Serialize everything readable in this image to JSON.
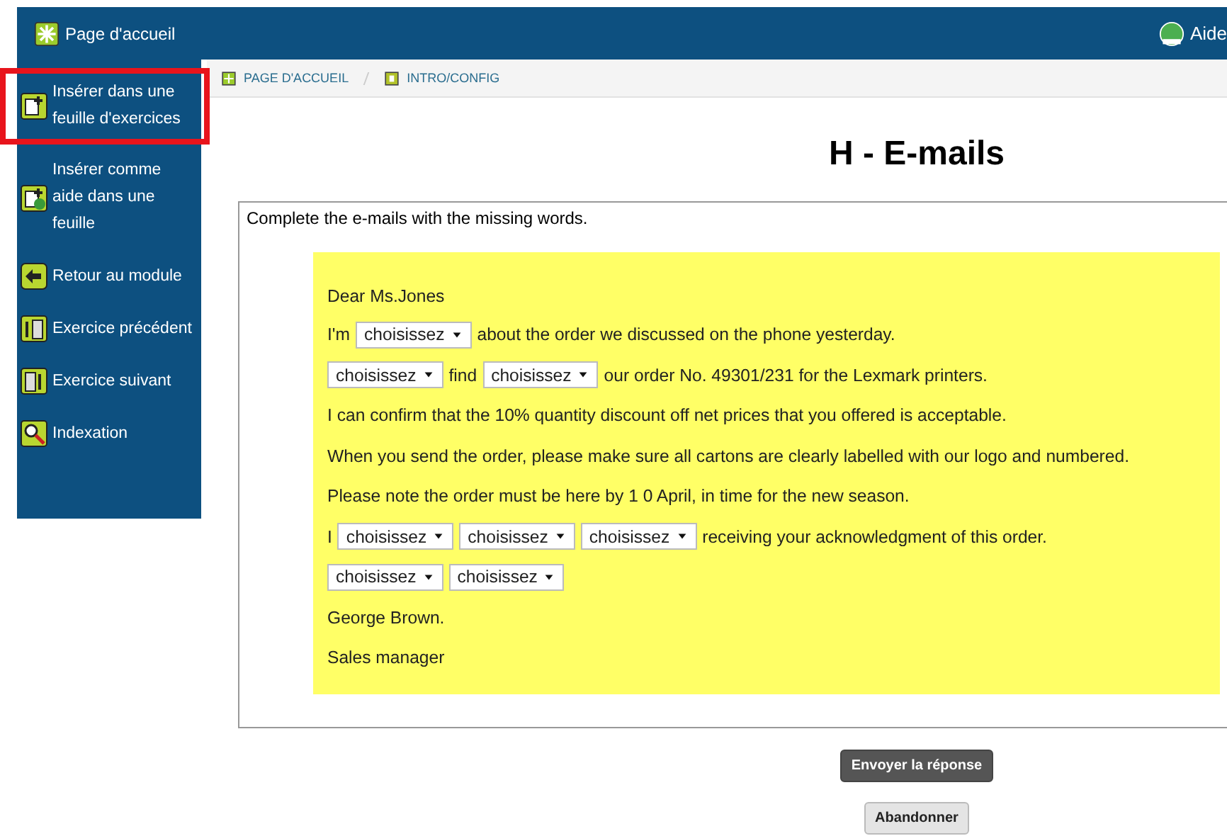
{
  "header": {
    "home": "Page d'accueil",
    "help": "Aide"
  },
  "sidebar": {
    "items": [
      {
        "label": "Insérer dans une feuille d'exercices",
        "highlighted": true
      },
      {
        "label": "Insérer comme aide dans une feuille",
        "highlighted": false
      },
      {
        "label": "Retour au module",
        "highlighted": false
      },
      {
        "label": "Exercice précédent",
        "highlighted": false
      },
      {
        "label": "Exercice suivant",
        "highlighted": false
      },
      {
        "label": "Indexation",
        "highlighted": false
      }
    ]
  },
  "breadcrumb": [
    "PAGE D'ACCUEIL",
    "INTRO/CONFIG"
  ],
  "title": "H - E-mails",
  "exercise": {
    "instruction": "Complete the e-mails with the missing words.",
    "lines": [
      [
        {
          "kind": "text",
          "text": "Dear Ms.Jones"
        }
      ],
      [
        {
          "kind": "text",
          "text": "I'm"
        },
        {
          "kind": "dropdown",
          "text": "choisissez"
        },
        {
          "kind": "text",
          "text": "about the order we discussed on the phone yesterday."
        }
      ],
      [
        {
          "kind": "dropdown",
          "text": "choisissez"
        },
        {
          "kind": "text",
          "text": "find"
        },
        {
          "kind": "dropdown",
          "text": "choisissez"
        },
        {
          "kind": "text",
          "text": "our order No. 49301/231 for the Lexmark printers."
        }
      ],
      [
        {
          "kind": "text",
          "text": "I can confirm that the 10% quantity discount off net prices that you offered is acceptable."
        }
      ],
      [
        {
          "kind": "text",
          "text": "When you send the order, please make sure all cartons are clearly labelled with our logo and numbered."
        }
      ],
      [
        {
          "kind": "text",
          "text": "Please note the order must be here by 1 0 April, in time for the new season."
        }
      ],
      [
        {
          "kind": "text",
          "text": "I"
        },
        {
          "kind": "dropdown",
          "text": "choisissez"
        },
        {
          "kind": "dropdown",
          "text": "choisissez"
        },
        {
          "kind": "dropdown",
          "text": "choisissez"
        },
        {
          "kind": "text",
          "text": "receiving your acknowledgment of this order."
        }
      ],
      [
        {
          "kind": "dropdown",
          "text": "choisissez"
        },
        {
          "kind": "dropdown",
          "text": "choisissez"
        }
      ],
      [
        {
          "kind": "text",
          "text": "George Brown."
        }
      ],
      [
        {
          "kind": "text",
          "text": "Sales manager"
        }
      ]
    ]
  },
  "buttons": [
    {
      "label": "Envoyer la réponse",
      "kind": "primary"
    },
    {
      "label": "Abandonner",
      "kind": "secondary"
    }
  ]
}
